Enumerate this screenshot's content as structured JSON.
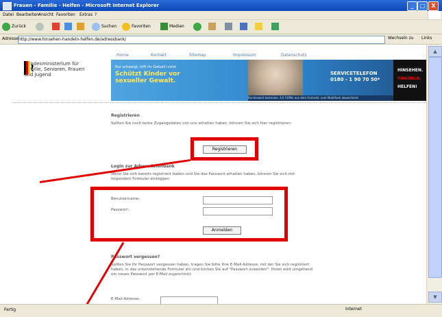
{
  "window": {
    "title": "Frauen - Familie - Helfen - Microsoft Internet Explorer",
    "min_label": "_",
    "max_label": "□",
    "close_label": "X"
  },
  "menu": [
    "Datei",
    "Bearbeiten",
    "Ansicht",
    "Favoriten",
    "Extras",
    "?"
  ],
  "toolbar": {
    "back_label": "Zurück",
    "search_label": "Suchen",
    "favorites_label": "Favoriten",
    "media_label": "Medien"
  },
  "address": {
    "label": "Adresse",
    "url": "http://www.hinsehen-handeln-helfen.de/adressbank/",
    "go_label": "Wechseln zu",
    "links_label": "Links"
  },
  "page": {
    "logo_text": "Bundesministerium für Familie, Senioren, Frauen und Jugend",
    "nav": [
      "Home",
      "Kontakt",
      "Sitemap",
      "Impressum",
      "Datenschutz"
    ],
    "banner": {
      "slogan1": "Nur schweigt, hilft ihr Gefuehl nicht",
      "slogan2": "Schützt Kinder vor sexueller Gewalt.",
      "phone_title": "SERVICETELEFON",
      "phone_number": "0180 - 1 90 70 50*",
      "side1": "HINSEHEN.",
      "side2": "HANDELN.",
      "side3": "HELFEN!",
      "footnote": "Bundesweit kostenlos: 4,6 Ct/Min aus dem Festnetz; vom Mobilfunk abweichend"
    },
    "register": {
      "heading": "Registrieren",
      "text": "Sollten Sie noch keine Zugangsdaten von uns erhalten haben, können Sie sich hier registrieren.",
      "button": "Registrieren"
    },
    "login": {
      "heading": "Login zur Adressdatenbank",
      "text": "Wenn Sie sich bereits registriert haben und Sie das Passwort erhalten haben, können Sie sich mit folgendem Formular einloggen:",
      "user_label": "Benutzername:",
      "pass_label": "Passwort:",
      "button": "Anmelden"
    },
    "forgot": {
      "heading": "Passwort vergessen?",
      "text": "Sollten Sie Ihr Passwort vergessen haben, tragen Sie bitte Ihre E-Mail-Adresse, mit der Sie sich registriert haben, in das untenstehende Formular ein und klicken Sie auf \"Passwort zusenden\". Ihnen wird umgehend ein neues Passwort per E-Mail zugeschickt.",
      "email_label": "E-Mail-Adresse:"
    }
  },
  "status": {
    "left": "Fertig",
    "zone": "Internet"
  },
  "colors": {
    "annotation_red": "#e30000",
    "xp_blue": "#0b47b8",
    "link_blue": "#5a78a8"
  }
}
